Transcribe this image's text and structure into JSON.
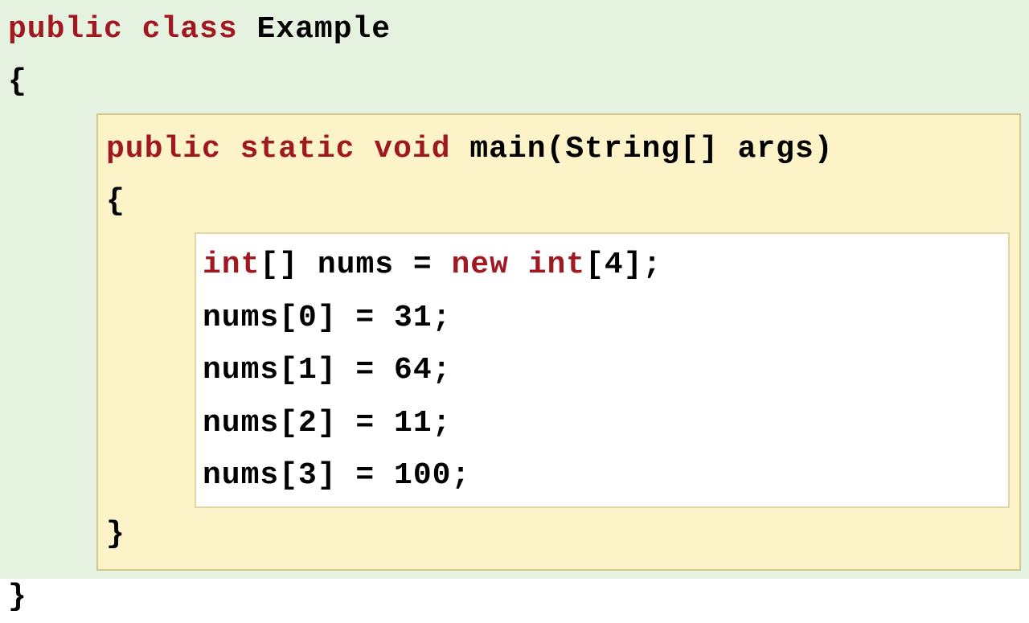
{
  "classDecl": {
    "kw_public": "public",
    "kw_class": "class",
    "name": "Example",
    "openBrace": "{",
    "closeBrace": "}"
  },
  "methodDecl": {
    "kw_public": "public",
    "kw_static": "static",
    "kw_void": "void",
    "signature": "main(String[] args)",
    "openBrace": "{",
    "closeBrace": "}"
  },
  "body": {
    "decl": {
      "kw_int": "int",
      "rest1": "[] nums = ",
      "kw_new": "new",
      "kw_int2": "int",
      "rest2": "[4];"
    },
    "assigns": [
      "nums[0] = 31;",
      "nums[1] = 64;",
      "nums[2] = 11;",
      "nums[3] = 100;"
    ]
  }
}
